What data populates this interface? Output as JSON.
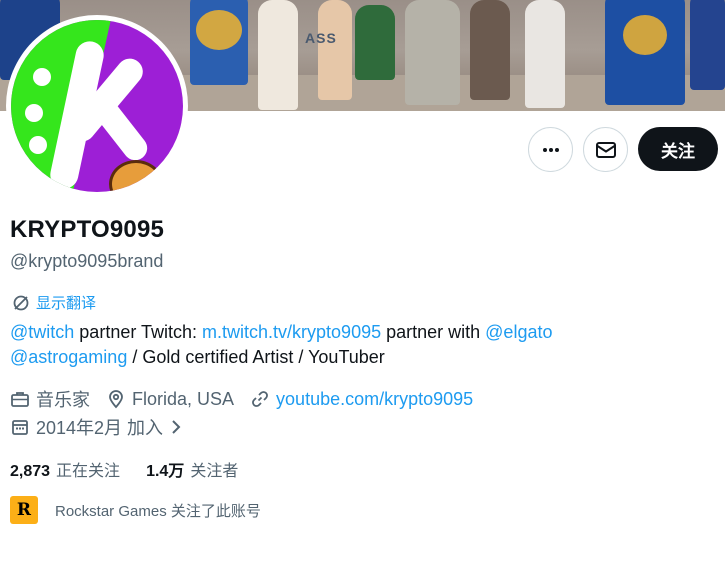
{
  "profile": {
    "display_name": "KRYPTO9095",
    "handle": "@krypto9095brand",
    "show_translation": "显示翻译",
    "bio": {
      "line1": [
        {
          "text": "@twitch",
          "link": true
        },
        {
          "text": " partner Twitch: ",
          "link": false
        },
        {
          "text": "m.twitch.tv/krypto9095",
          "link": true
        },
        {
          "text": " partner with ",
          "link": false
        },
        {
          "text": "@elgato",
          "link": true
        }
      ],
      "line2": [
        {
          "text": "@astrogaming",
          "link": true
        },
        {
          "text": " / Gold certified Artist / YouTuber",
          "link": false
        }
      ]
    },
    "profession": "音乐家",
    "location": "Florida, USA",
    "website": "youtube.com/krypto9095",
    "joined": "2014年2月 加入",
    "following_count": "2,873",
    "following_label": "正在关注",
    "followers_count": "1.4万",
    "followers_label": "关注者",
    "followed_by": "Rockstar Games 关注了此账号",
    "followed_by_logo_text": "R"
  },
  "actions": {
    "more_icon": "more-dots-icon",
    "message_icon": "envelope-icon",
    "follow_label": "关注"
  },
  "banner": {
    "court_text": "ASS"
  },
  "colors": {
    "link": "#1d9bf0",
    "text_primary": "#0f1419",
    "text_secondary": "#536471",
    "follow_button_bg": "#0f1419",
    "avatar_green": "#35e61c",
    "avatar_purple": "#9d1fd6",
    "rockstar_yellow": "#fcaf17"
  }
}
